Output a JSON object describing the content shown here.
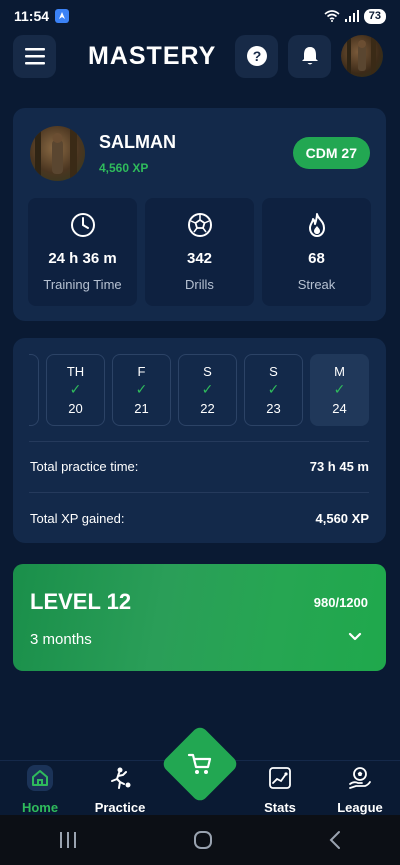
{
  "status": {
    "time": "11:54",
    "battery": "73"
  },
  "header": {
    "title": "MASTERY"
  },
  "profile": {
    "name": "SALMAN",
    "xp": "4,560 XP",
    "position_badge": "CDM 27",
    "stats": [
      {
        "value": "24 h 36 m",
        "label": "Training Time",
        "icon": "clock-icon"
      },
      {
        "value": "342",
        "label": "Drills",
        "icon": "soccer-ball-icon"
      },
      {
        "value": "68",
        "label": "Streak",
        "icon": "flame-icon"
      }
    ]
  },
  "week": {
    "days": [
      {
        "letter": "TH",
        "num": "20",
        "done": true
      },
      {
        "letter": "F",
        "num": "21",
        "done": true
      },
      {
        "letter": "S",
        "num": "22",
        "done": true
      },
      {
        "letter": "S",
        "num": "23",
        "done": true
      },
      {
        "letter": "M",
        "num": "24",
        "done": true
      }
    ],
    "summary": [
      {
        "label": "Total practice time:",
        "value": "73 h 45 m"
      },
      {
        "label": "Total XP gained:",
        "value": "4,560 XP"
      }
    ]
  },
  "level": {
    "title": "LEVEL 12",
    "progress": "980/1200",
    "duration": "3 months"
  },
  "nav": {
    "items": [
      {
        "label": "Home",
        "icon": "home-icon"
      },
      {
        "label": "Practice",
        "icon": "kick-icon"
      },
      {
        "label": "Stats",
        "icon": "stats-icon"
      },
      {
        "label": "League",
        "icon": "league-icon"
      }
    ]
  },
  "colors": {
    "accent": "#22a752",
    "background": "#0a1a33",
    "card": "#13294a"
  }
}
